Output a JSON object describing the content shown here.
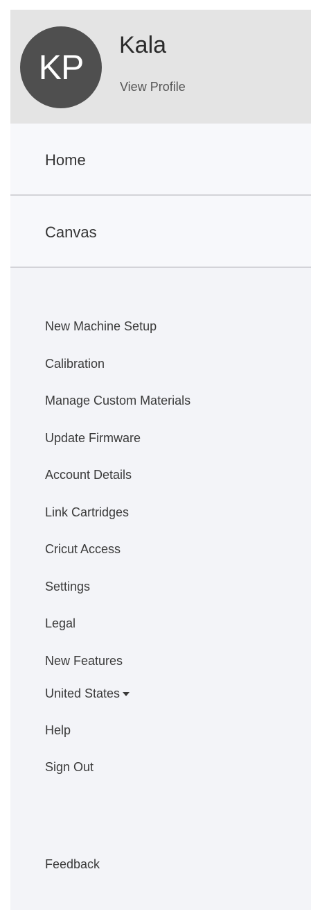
{
  "profile": {
    "initials": "KP",
    "name": "Kala",
    "view_profile": "View Profile"
  },
  "nav": {
    "home": "Home",
    "canvas": "Canvas"
  },
  "menu": {
    "items": [
      "New Machine Setup",
      "Calibration",
      "Manage Custom Materials",
      "Update Firmware",
      "Account Details",
      "Link Cartridges",
      "Cricut Access",
      "Settings",
      "Legal",
      "New Features"
    ],
    "country": "United States",
    "help": "Help",
    "sign_out": "Sign Out",
    "feedback": "Feedback"
  }
}
